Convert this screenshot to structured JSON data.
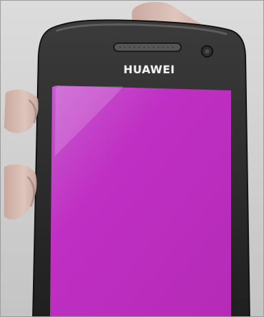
{
  "photo": {
    "brand_text": "HUAWEI",
    "screen_color": "#c02ec4",
    "device_color": "#2b2b2b",
    "background_color": "#d6d6d6",
    "skin_color": "#d7b8ae"
  }
}
